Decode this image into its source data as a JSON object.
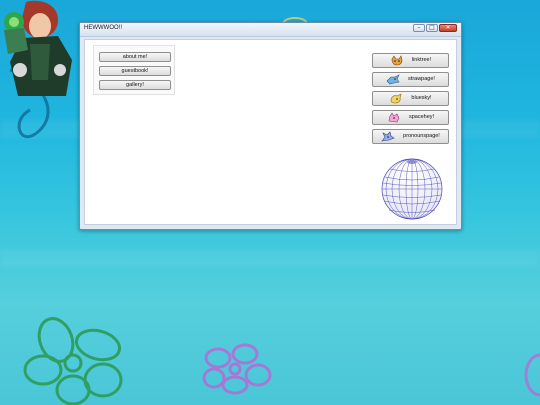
{
  "window": {
    "title": "HEWWWOO!!",
    "controls": {
      "minimize": "–",
      "maximize": "□",
      "close": "✕"
    }
  },
  "nav": {
    "items": [
      {
        "label": "about me!"
      },
      {
        "label": "guestbook!"
      },
      {
        "label": "gallery!"
      }
    ]
  },
  "links": [
    {
      "label": "linktree!",
      "icon": "orange-cat-icon"
    },
    {
      "label": "strawpage!",
      "icon": "blue-dragon-icon"
    },
    {
      "label": "bluesky!",
      "icon": "yellow-pokemon-icon"
    },
    {
      "label": "spacehey!",
      "icon": "pink-pokemon-icon"
    },
    {
      "label": "pronounspage!",
      "icon": "purple-pokemon-icon"
    }
  ],
  "colors": {
    "sky": "#1fb6df",
    "flower_green": "#3fbf6d",
    "flower_purple": "#b66bd6",
    "globe_lines": "#4a4ab8"
  }
}
